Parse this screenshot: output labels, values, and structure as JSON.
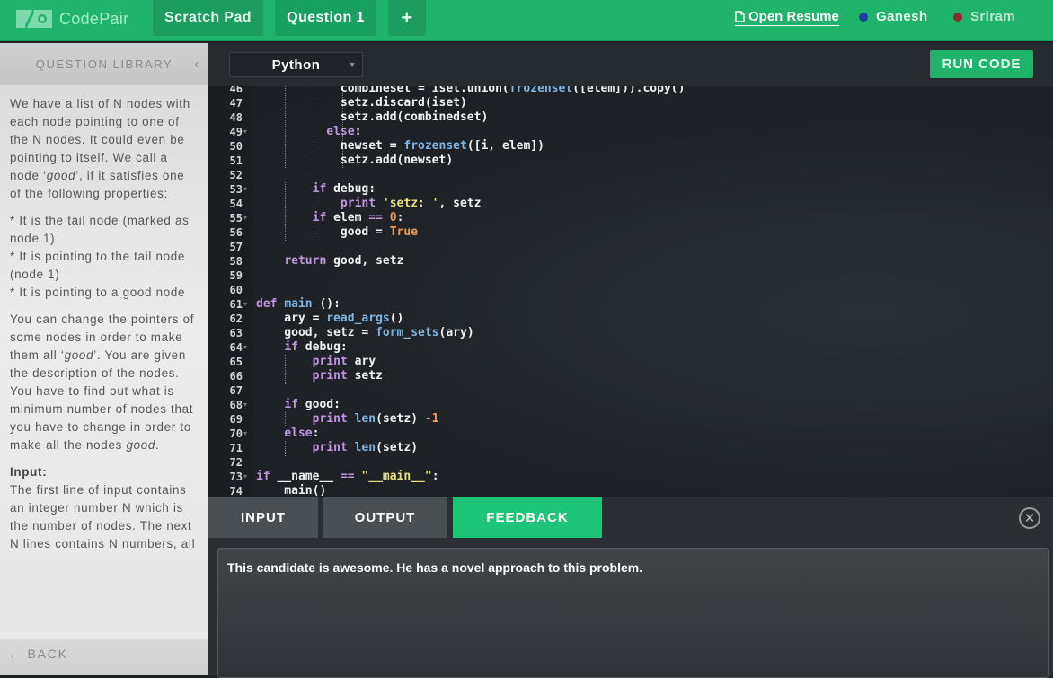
{
  "header": {
    "brand": "CodePair",
    "tabs": [
      {
        "label": "Scratch Pad"
      },
      {
        "label": "Question 1"
      },
      {
        "label": "+"
      }
    ],
    "open_resume": "Open Resume",
    "users": [
      {
        "name": "Ganesh",
        "color": "#1c3f9a"
      },
      {
        "name": "Sriram",
        "color": "#8a2a2a"
      }
    ]
  },
  "sidebar": {
    "title": "QUESTION LIBRARY",
    "question": {
      "p1a": "We have a list of N nodes with each node pointing to one of the N nodes. It could even be pointing to itself. We call a node ‘",
      "p1_em": "good",
      "p1b": "’, if it satisfies one of the following properties:",
      "bullets": [
        "* It is the tail node (marked as node 1)",
        "* It is pointing to the tail node (node 1)",
        "* It is pointing to a good node"
      ],
      "p2a": "You can change the pointers of some nodes in order to make them all ‘",
      "p2_em": "good",
      "p2b": "’. You are given the description of the nodes. You have to find out what is minimum number of nodes that you have to change in order to make all the nodes ",
      "p2_em2": "good",
      "p2c": ".",
      "input_heading": "Input:",
      "input_text": "The first line of input contains an integer number N which is the number of nodes. The next N lines contains N numbers, all"
    },
    "back": "← BACK"
  },
  "editor": {
    "language": "Python",
    "run_label": "RUN CODE",
    "lines": [
      {
        "n": "46",
        "fold": false,
        "html": "            combineset = iset.union(<span class=\"fn\">frozenset</span>([elem])).copy()"
      },
      {
        "n": "47",
        "fold": false,
        "html": "            setz.discard(iset)"
      },
      {
        "n": "48",
        "fold": false,
        "html": "            setz.add(combinedset)"
      },
      {
        "n": "49",
        "fold": true,
        "html": "          <span class=\"kw\">else</span>:"
      },
      {
        "n": "50",
        "fold": false,
        "html": "            newset = <span class=\"fn\">frozenset</span>([i, elem])"
      },
      {
        "n": "51",
        "fold": false,
        "html": "            setz.add(newset)"
      },
      {
        "n": "52",
        "fold": false,
        "html": ""
      },
      {
        "n": "53",
        "fold": true,
        "html": "        <span class=\"kw\">if</span> debug:"
      },
      {
        "n": "54",
        "fold": false,
        "html": "            <span class=\"kw\">print</span> <span class=\"st\">'setz: '</span>, setz"
      },
      {
        "n": "55",
        "fold": true,
        "html": "        <span class=\"kw\">if</span> elem <span class=\"kw\">==</span> <span class=\"nu\">0</span>:"
      },
      {
        "n": "56",
        "fold": false,
        "html": "            good = <span class=\"nu\">True</span>"
      },
      {
        "n": "57",
        "fold": false,
        "html": ""
      },
      {
        "n": "58",
        "fold": false,
        "html": "    <span class=\"kw\">return</span> good, setz"
      },
      {
        "n": "59",
        "fold": false,
        "html": ""
      },
      {
        "n": "60",
        "fold": false,
        "html": ""
      },
      {
        "n": "61",
        "fold": true,
        "html": "<span class=\"kw\">def</span> <span class=\"fn\">main</span> ():"
      },
      {
        "n": "62",
        "fold": false,
        "html": "    ary = <span class=\"fn\">read_args</span>()"
      },
      {
        "n": "63",
        "fold": false,
        "html": "    good, setz = <span class=\"fn\">form_sets</span>(ary)"
      },
      {
        "n": "64",
        "fold": true,
        "html": "    <span class=\"kw\">if</span> debug:"
      },
      {
        "n": "65",
        "fold": false,
        "html": "        <span class=\"kw\">print</span> ary"
      },
      {
        "n": "66",
        "fold": false,
        "html": "        <span class=\"kw\">print</span> setz"
      },
      {
        "n": "67",
        "fold": false,
        "html": ""
      },
      {
        "n": "68",
        "fold": true,
        "html": "    <span class=\"kw\">if</span> good:"
      },
      {
        "n": "69",
        "fold": false,
        "html": "        <span class=\"kw\">print</span> <span class=\"fn\">len</span>(setz) <span class=\"nu\">-1</span>"
      },
      {
        "n": "70",
        "fold": true,
        "html": "    <span class=\"kw\">else</span>:"
      },
      {
        "n": "71",
        "fold": false,
        "html": "        <span class=\"kw\">print</span> <span class=\"fn\">len</span>(setz)"
      },
      {
        "n": "72",
        "fold": false,
        "html": ""
      },
      {
        "n": "73",
        "fold": true,
        "html": "<span class=\"kw\">if</span> __name__ <span class=\"kw\">==</span> <span class=\"st\">\"__main__\"</span>:"
      },
      {
        "n": "74",
        "fold": false,
        "html": "    main()"
      }
    ]
  },
  "panel": {
    "tabs": [
      {
        "label": "INPUT"
      },
      {
        "label": "OUTPUT"
      },
      {
        "label": "FEEDBACK"
      }
    ],
    "close_symbol": "✕",
    "feedback_text": "This candidate is awesome. He has a novel approach to this problem."
  },
  "colors": {
    "brand_green": "#20b46a",
    "active_tab": "#1ec477",
    "tab_gray": "#4a4f54"
  }
}
